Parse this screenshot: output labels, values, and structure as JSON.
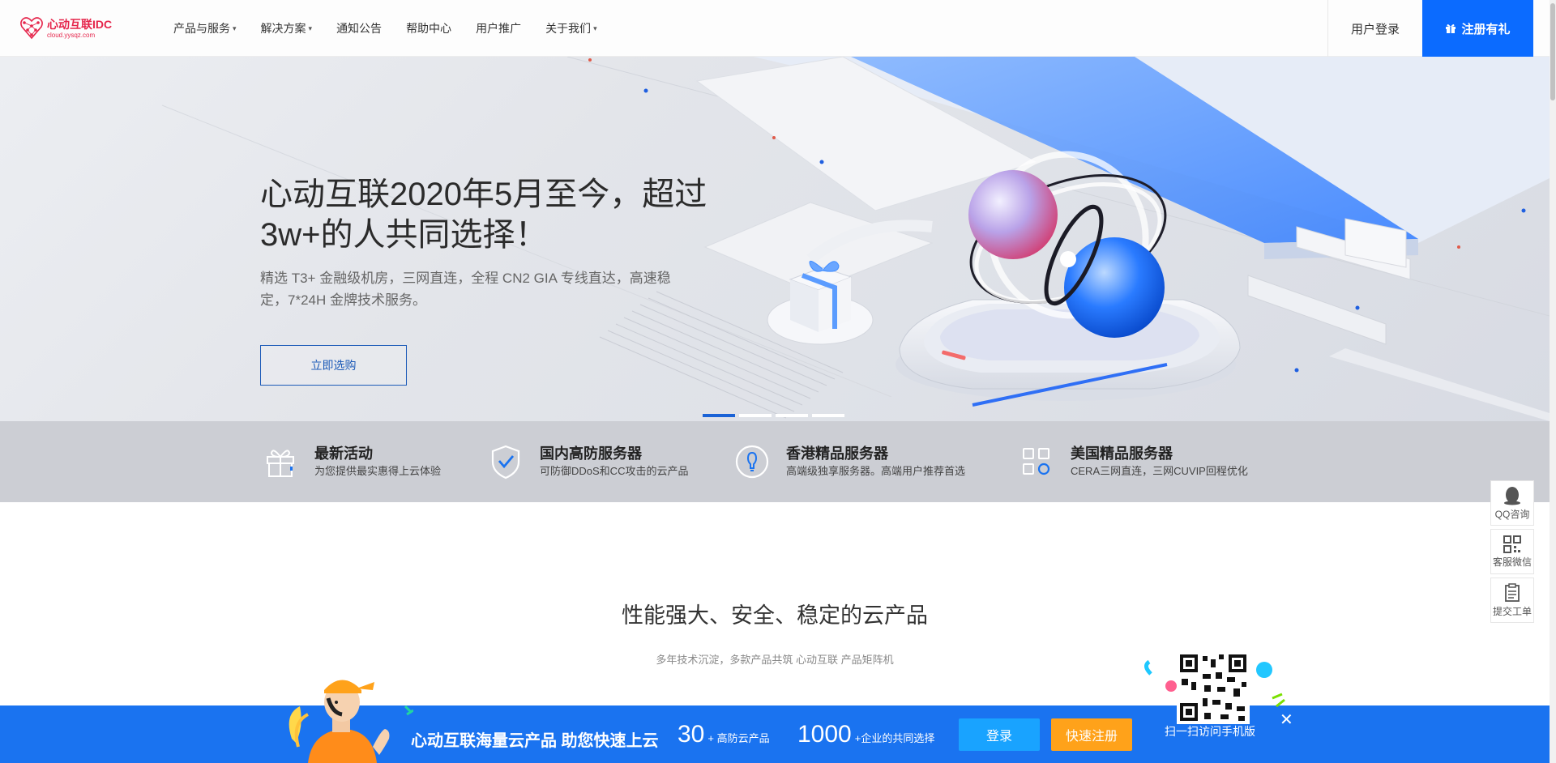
{
  "header": {
    "logo_name": "心动互联IDC",
    "logo_url": "cloud.yysqz.com",
    "nav": [
      {
        "label": "产品与服务",
        "dropdown": true
      },
      {
        "label": "解决方案",
        "dropdown": true
      },
      {
        "label": "通知公告",
        "dropdown": false
      },
      {
        "label": "帮助中心",
        "dropdown": false
      },
      {
        "label": "用户推广",
        "dropdown": false
      },
      {
        "label": "关于我们",
        "dropdown": true
      }
    ],
    "login_label": "用户登录",
    "register_label": "注册有礼"
  },
  "banner": {
    "title": "心动互联2020年5月至今，超过3w+的人共同选择！",
    "description": "精选 T3+ 金融级机房，三网直连，全程 CN2 GIA 专线直达，高速稳定，7*24H 金牌技术服务。",
    "button_label": "立即选购",
    "slides": 4,
    "active_slide": 1
  },
  "features": [
    {
      "title": "最新活动",
      "desc": "为您提供最实惠得上云体验",
      "icon": "gift-icon"
    },
    {
      "title": "国内高防服务器",
      "desc": "可防御DDoS和CC攻击的云产品",
      "icon": "shield-check-icon"
    },
    {
      "title": "香港精品服务器",
      "desc": "高端级独享服务器。高端用户推荐首选",
      "icon": "bulb-icon"
    },
    {
      "title": "美国精品服务器",
      "desc": "CERA三网直连，三网CUVIP回程优化",
      "icon": "grid-apps-icon"
    }
  ],
  "side_float": [
    {
      "label": "QQ咨询",
      "icon": "qq-penguin-icon"
    },
    {
      "label": "客服微信",
      "icon": "qrcode-icon"
    },
    {
      "label": "提交工单",
      "icon": "clipboard-icon"
    }
  ],
  "section": {
    "title": "性能强大、安全、稳定的云产品",
    "subtitle": "多年技术沉淀，多款产品共筑 心动互联 产品矩阵机"
  },
  "bottom_bar": {
    "slogan": "心动互联海量云产品 助您快速上云",
    "stats": [
      {
        "num": "30",
        "label": "+ 高防云产品"
      },
      {
        "num": "1000",
        "label": "+企业的共同选择"
      }
    ],
    "login_label": "登录",
    "quick_register_label": "快速注册",
    "qr_label": "扫一扫访问手机版",
    "close_symbol": "✕"
  },
  "colors": {
    "primary": "#0b6bff",
    "bottom_bar": "#1a73f0",
    "orange": "#ffa21a",
    "light_blue": "#19a3ff",
    "logo_red": "#e5254b"
  }
}
